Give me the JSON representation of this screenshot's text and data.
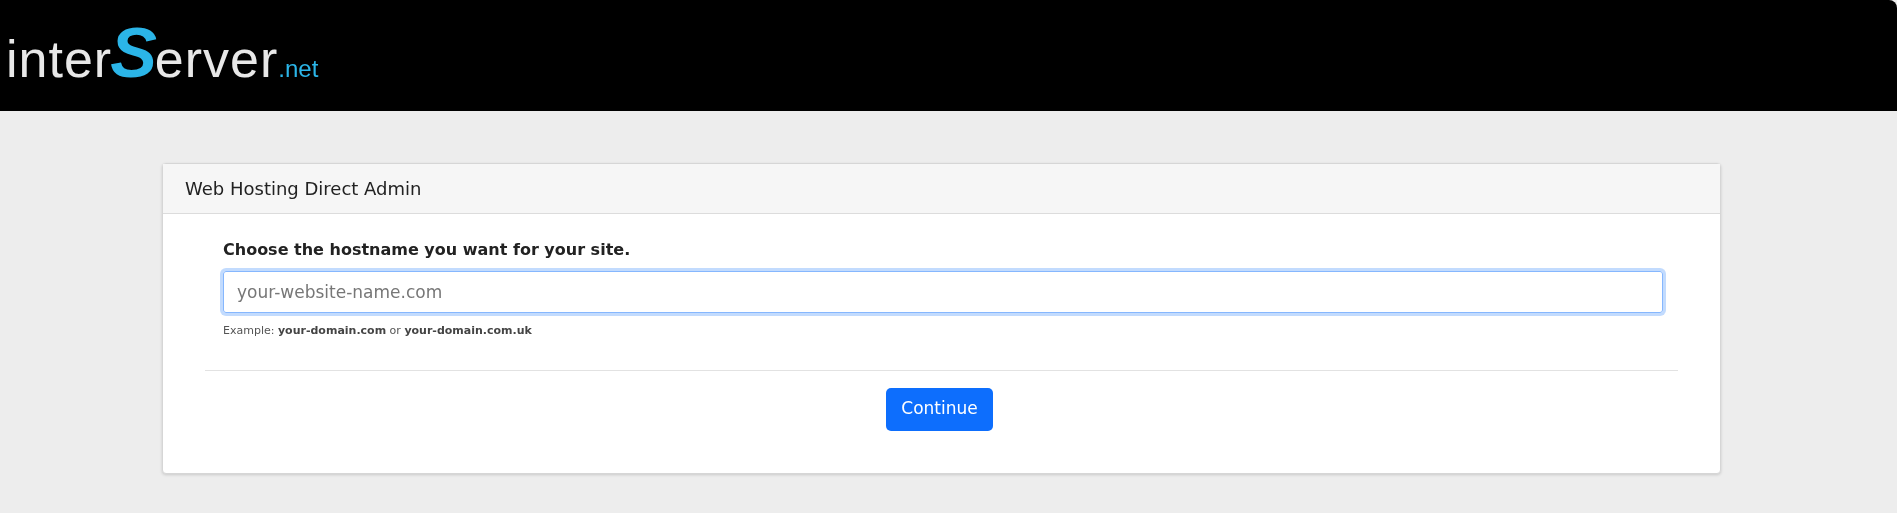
{
  "logo": {
    "before": "inter",
    "accent": "S",
    "after": "erver",
    "suffix": ".net"
  },
  "card": {
    "title": "Web Hosting Direct Admin",
    "label": "Choose the hostname you want for your site.",
    "field": {
      "placeholder": "your-website-name.com",
      "focused": true
    },
    "help": "Example: **your-domain.com** or **your-domain.com.uk**",
    "button": "Continue"
  }
}
